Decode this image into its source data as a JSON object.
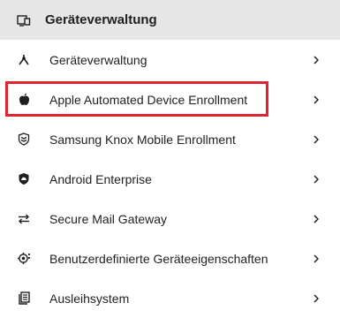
{
  "header": {
    "title": "Geräteverwaltung",
    "icon": "devices-icon"
  },
  "menu": {
    "items": [
      {
        "label": "Geräteverwaltung",
        "icon": "network-icon"
      },
      {
        "label": "Apple Automated Device Enrollment",
        "icon": "apple-icon"
      },
      {
        "label": "Samsung Knox Mobile Enrollment",
        "icon": "shield-chevrons-icon"
      },
      {
        "label": "Android Enterprise",
        "icon": "android-shield-icon"
      },
      {
        "label": "Secure Mail Gateway",
        "icon": "swap-arrows-icon"
      },
      {
        "label": "Benutzerdefinierte Geräteeigenschaften",
        "icon": "device-gear-icon"
      },
      {
        "label": "Ausleihsystem",
        "icon": "catalog-icon"
      }
    ]
  },
  "highlight_color": "#e0242f"
}
